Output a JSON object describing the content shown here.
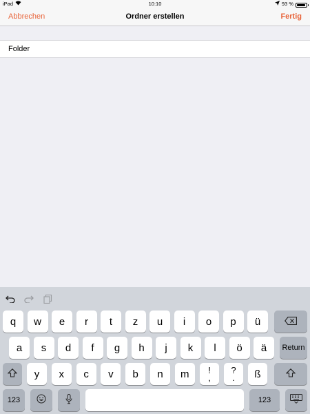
{
  "status_bar": {
    "device": "iPad",
    "time": "10:10",
    "battery_percent": "93 %",
    "battery_level": 0.93,
    "icons": [
      "wifi-icon",
      "location-arrow-icon",
      "battery-icon"
    ]
  },
  "nav": {
    "cancel_label": "Abbrechen",
    "title": "Ordner erstellen",
    "done_label": "Fertig",
    "accent_color": "#e8643a"
  },
  "form": {
    "folder_name_value": "Folder"
  },
  "keyboard": {
    "shortcuts": [
      "undo-icon",
      "redo-icon",
      "paste-icon"
    ],
    "row1": [
      "q",
      "w",
      "e",
      "r",
      "t",
      "z",
      "u",
      "i",
      "o",
      "p",
      "ü"
    ],
    "row2": [
      "a",
      "s",
      "d",
      "f",
      "g",
      "h",
      "j",
      "k",
      "l",
      "ö",
      "ä"
    ],
    "return_label": "Return",
    "row3": [
      "y",
      "x",
      "c",
      "v",
      "b",
      "n",
      "m"
    ],
    "punct1": {
      "top": "!",
      "bottom": ","
    },
    "punct2": {
      "top": "?",
      "bottom": "."
    },
    "sz": "ß",
    "numbers_label": "123",
    "icons": [
      "backspace-icon",
      "shift-icon",
      "emoji-icon",
      "microphone-icon",
      "keyboard-dismiss-icon"
    ]
  }
}
